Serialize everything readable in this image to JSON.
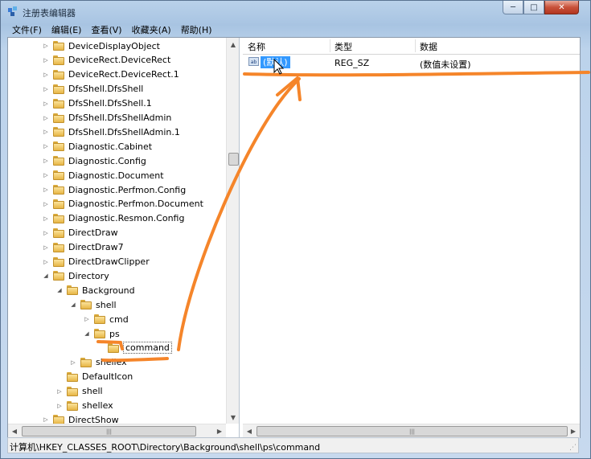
{
  "window": {
    "title": "注册表编辑器",
    "controls": {
      "minimize": "─",
      "maximize": "□",
      "close": "✕"
    }
  },
  "menu": [
    {
      "label": "文件(F)"
    },
    {
      "label": "编辑(E)"
    },
    {
      "label": "查看(V)"
    },
    {
      "label": "收藏夹(A)"
    },
    {
      "label": "帮助(H)"
    }
  ],
  "tree": {
    "nodes": [
      {
        "label": "DeviceDisplayObject",
        "twisty": "▷"
      },
      {
        "label": "DeviceRect.DeviceRect",
        "twisty": "▷"
      },
      {
        "label": "DeviceRect.DeviceRect.1",
        "twisty": "▷"
      },
      {
        "label": "DfsShell.DfsShell",
        "twisty": "▷"
      },
      {
        "label": "DfsShell.DfsShell.1",
        "twisty": "▷"
      },
      {
        "label": "DfsShell.DfsShellAdmin",
        "twisty": "▷"
      },
      {
        "label": "DfsShell.DfsShellAdmin.1",
        "twisty": "▷"
      },
      {
        "label": "Diagnostic.Cabinet",
        "twisty": "▷"
      },
      {
        "label": "Diagnostic.Config",
        "twisty": "▷"
      },
      {
        "label": "Diagnostic.Document",
        "twisty": "▷"
      },
      {
        "label": "Diagnostic.Perfmon.Config",
        "twisty": "▷"
      },
      {
        "label": "Diagnostic.Perfmon.Document",
        "twisty": "▷"
      },
      {
        "label": "Diagnostic.Resmon.Config",
        "twisty": "▷"
      },
      {
        "label": "DirectDraw",
        "twisty": "▷"
      },
      {
        "label": "DirectDraw7",
        "twisty": "▷"
      },
      {
        "label": "DirectDrawClipper",
        "twisty": "▷"
      },
      {
        "label": "Directory",
        "twisty": "◢"
      },
      {
        "label": "Background",
        "twisty": "◢"
      },
      {
        "label": "shell",
        "twisty": "◢"
      },
      {
        "label": "cmd",
        "twisty": "▷"
      },
      {
        "label": "ps",
        "twisty": "◢"
      },
      {
        "label": "command",
        "twisty": ""
      },
      {
        "label": "shellex",
        "twisty": "▷"
      },
      {
        "label": "DefaultIcon",
        "twisty": ""
      },
      {
        "label": "shell",
        "twisty": "▷"
      },
      {
        "label": "shellex",
        "twisty": "▷"
      },
      {
        "label": "DirectShow",
        "twisty": "▷"
      }
    ]
  },
  "list": {
    "columns": {
      "name": "名称",
      "type": "类型",
      "data": "数据"
    },
    "rows": [
      {
        "name": "(默认)",
        "type": "REG_SZ",
        "data": "(数值未设置)",
        "icon": "ab"
      }
    ]
  },
  "scroll": {
    "up": "▲",
    "down": "▼",
    "left": "◀",
    "right": "▶",
    "grip": "|||"
  },
  "status": {
    "path": "计算机\\HKEY_CLASSES_ROOT\\Directory\\Background\\shell\\ps\\command"
  },
  "colors": {
    "annotation": "#f5852a",
    "selection": "#3399ff"
  }
}
